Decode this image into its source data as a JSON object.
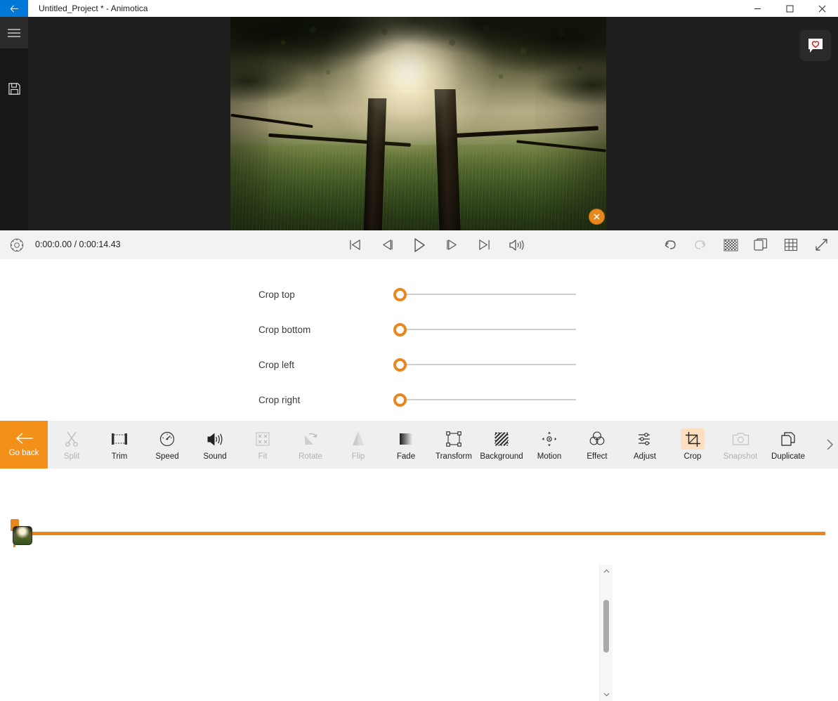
{
  "window": {
    "title": "Untitled_Project * - Animotica",
    "back_icon": "back-arrow-icon",
    "minimize_label": "—",
    "maximize_label": "□",
    "close_label": "✕"
  },
  "rail": {
    "menu_icon": "hamburger-menu-icon",
    "save_icon": "save-disk-icon"
  },
  "preview": {
    "close_clip_icon": "close-circle-icon",
    "feedback_icon": "heart-feedback-icon"
  },
  "transport": {
    "settings_icon": "settings-gear-icon",
    "timecode": "0:00:0.00 / 0:00:14.43",
    "current_time": "0:00:0.00",
    "total_time": "0:00:14.43",
    "controls": [
      {
        "name": "skip-to-start-button",
        "icon": "skip-start-icon"
      },
      {
        "name": "previous-frame-button",
        "icon": "prev-frame-icon"
      },
      {
        "name": "play-button",
        "icon": "play-icon"
      },
      {
        "name": "next-frame-button",
        "icon": "next-frame-icon"
      },
      {
        "name": "skip-to-end-button",
        "icon": "skip-end-icon"
      },
      {
        "name": "volume-button",
        "icon": "volume-icon"
      }
    ],
    "right_controls": [
      {
        "name": "undo-button",
        "icon": "undo-icon",
        "enabled": true
      },
      {
        "name": "redo-button",
        "icon": "redo-icon",
        "enabled": false
      },
      {
        "name": "checkerboard-button",
        "icon": "checkerboard-icon",
        "enabled": true
      },
      {
        "name": "copy-button",
        "icon": "copy-icon",
        "enabled": true
      },
      {
        "name": "grid-button",
        "icon": "grid-icon",
        "enabled": true
      },
      {
        "name": "fullscreen-button",
        "icon": "expand-arrows-icon",
        "enabled": true
      }
    ]
  },
  "timeline": {
    "playhead_icon": "playhead-marker",
    "clip_thumbnail": "video-clip-thumbnail"
  },
  "crop_panel": {
    "rows": [
      {
        "label": "Crop top",
        "value": 0
      },
      {
        "label": "Crop bottom",
        "value": 0
      },
      {
        "label": "Crop left",
        "value": 0
      },
      {
        "label": "Crop right",
        "value": 0
      }
    ],
    "scroll_up_icon": "chevron-up-icon",
    "scroll_down_icon": "chevron-down-icon"
  },
  "toolbar": {
    "go_back_label": "Go back",
    "go_back_icon": "arrow-left-icon",
    "next_icon": "chevron-right-icon",
    "items": [
      {
        "label": "Split",
        "icon": "scissors-icon",
        "enabled": false,
        "active": false
      },
      {
        "label": "Trim",
        "icon": "trim-icon",
        "enabled": true,
        "active": false
      },
      {
        "label": "Speed",
        "icon": "speedometer-icon",
        "enabled": true,
        "active": false
      },
      {
        "label": "Sound",
        "icon": "volume-icon",
        "enabled": true,
        "active": false
      },
      {
        "label": "Fit",
        "icon": "fit-icon",
        "enabled": false,
        "active": false
      },
      {
        "label": "Rotate",
        "icon": "rotate-icon",
        "enabled": false,
        "active": false
      },
      {
        "label": "Flip",
        "icon": "flip-icon",
        "enabled": false,
        "active": false
      },
      {
        "label": "Fade",
        "icon": "fade-icon",
        "enabled": true,
        "active": false
      },
      {
        "label": "Transform",
        "icon": "transform-icon",
        "enabled": true,
        "active": false
      },
      {
        "label": "Background",
        "icon": "background-icon",
        "enabled": true,
        "active": false
      },
      {
        "label": "Motion",
        "icon": "motion-icon",
        "enabled": true,
        "active": false
      },
      {
        "label": "Effect",
        "icon": "effect-icon",
        "enabled": true,
        "active": false
      },
      {
        "label": "Adjust",
        "icon": "sliders-icon",
        "enabled": true,
        "active": false
      },
      {
        "label": "Crop",
        "icon": "crop-icon",
        "enabled": true,
        "active": true
      },
      {
        "label": "Snapshot",
        "icon": "camera-icon",
        "enabled": false,
        "active": false
      },
      {
        "label": "Duplicate",
        "icon": "duplicate-icon",
        "enabled": true,
        "active": false
      }
    ]
  },
  "colors": {
    "accent": "#e8871e",
    "go_back_bg": "#f39019",
    "title_accent": "#0078d7",
    "active_tool_bg": "#fbdfc0",
    "stage_bg": "#1f1f1f"
  }
}
